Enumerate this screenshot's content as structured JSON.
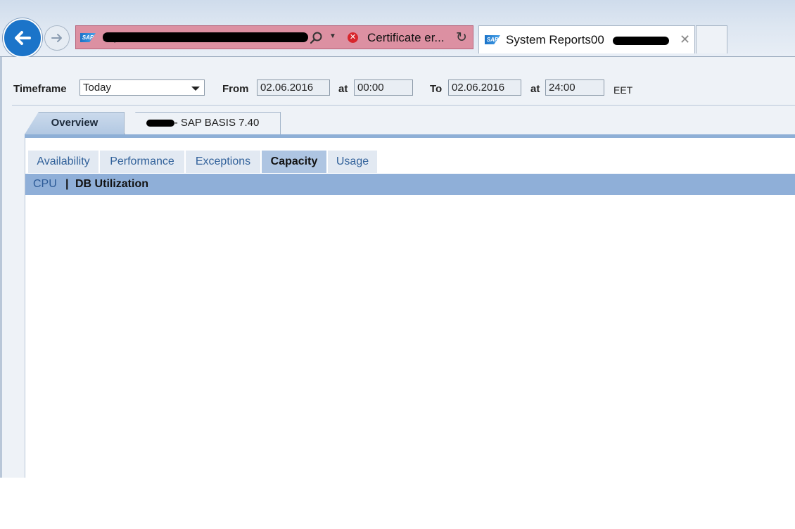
{
  "browser": {
    "address_url": "https://...",
    "certificate_label": "Certificate er...",
    "tab_title": "System Reports00",
    "icons": [
      "back-arrow-icon",
      "forward-arrow-icon",
      "sap-logo-icon",
      "search-icon",
      "dropdown-icon",
      "certificate-error-icon",
      "refresh-icon",
      "close-icon"
    ],
    "cert_color": "#d8252c",
    "address_bar_color": "#dc90a2"
  },
  "filter": {
    "timeframe_label": "Timeframe",
    "timeframe_value": "Today",
    "from_label": "From",
    "from_date": "02.06.2016",
    "at_label": "at",
    "from_time": "00:00",
    "to_label": "To",
    "to_date": "02.06.2016",
    "to_time": "24:00",
    "timezone": "EET"
  },
  "main_tabs": {
    "overview": "Overview",
    "system": "- SAP BASIS 7.40"
  },
  "sub_tabs": [
    "Availability",
    "Performance",
    "Exceptions",
    "Capacity",
    "Usage"
  ],
  "sub_tab_selected": "Capacity",
  "capacity_views": {
    "cpu": "CPU",
    "separator": "|",
    "db": "DB Utilization"
  },
  "colors": {
    "accent": "#8fafd8",
    "active_tab": "#aec5e2",
    "link": "#31619a"
  }
}
